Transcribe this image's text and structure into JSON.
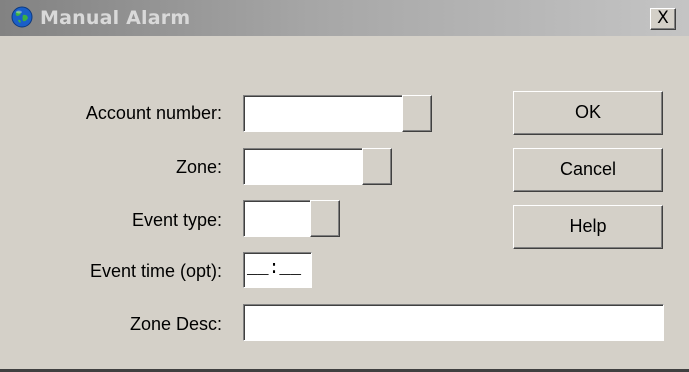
{
  "window": {
    "title": "Manual Alarm",
    "close_label": "X"
  },
  "form": {
    "account_number_label": "Account number:",
    "account_number_value": "",
    "zone_label": "Zone:",
    "zone_value": "",
    "event_type_label": "Event type:",
    "event_type_value": "",
    "event_time_label": "Event time (opt):",
    "event_time_value": "__:__",
    "zone_desc_label": "Zone Desc:",
    "zone_desc_value": ""
  },
  "buttons": {
    "ok_label": "OK",
    "cancel_label": "Cancel",
    "help_label": "Help"
  },
  "colors": {
    "dialog_face": "#d4d0c8",
    "title_text": "#d9d9d9",
    "field_background": "#ffffff"
  },
  "icons": {
    "title_icon": "globe-icon"
  }
}
